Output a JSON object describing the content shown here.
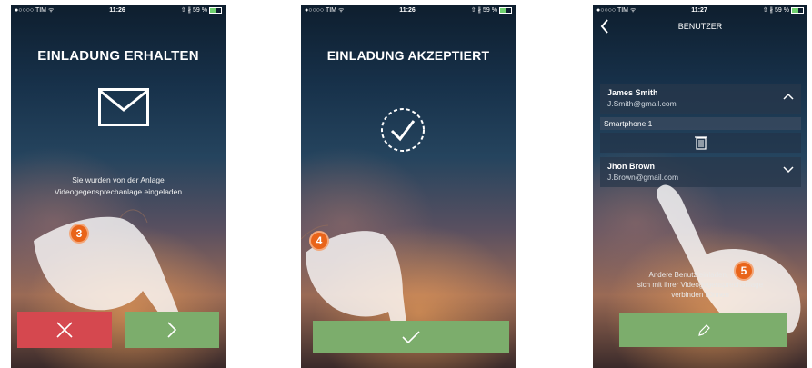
{
  "colors": {
    "red_button": "#d5484f",
    "green_button": "#7cad6c",
    "badge": "#e96419"
  },
  "status_bars": [
    {
      "carrier": "●○○○○ TIM ᯤ",
      "time": "11:26",
      "battery": "⇧ ∦ 59 %"
    },
    {
      "carrier": "●○○○○ TIM ᯤ",
      "time": "11:26",
      "battery": "⇧ ∦ 59 %"
    },
    {
      "carrier": "●○○○○ TIM ᯤ",
      "time": "11:27",
      "battery": "⇧ ∦ 59 %"
    }
  ],
  "screen1": {
    "title": "EINLADUNG ERHALTEN",
    "icon": "envelope-icon",
    "message_line1": "Sie wurden von der Anlage",
    "message_line2": "Videogegensprechanlage eingeladen",
    "step_badge": "3",
    "decline_icon": "close-icon",
    "accept_icon": "chevron-right-icon"
  },
  "screen2": {
    "title": "EINLADUNG AKZEPTIERT",
    "icon": "check-circle-icon",
    "step_badge": "4",
    "confirm_icon": "check-icon"
  },
  "screen3": {
    "header": "BENUTZER",
    "back_icon": "chevron-left-icon",
    "users": [
      {
        "name": "James Smith",
        "email": "J.Smith@gmail.com",
        "chevron": "chevron-up-icon"
      },
      {
        "name": "Jhon Brown",
        "email": "J.Brown@gmail.com",
        "chevron": "chevron-down-icon"
      }
    ],
    "device": "Smartphone 1",
    "trash_icon": "trash-icon",
    "info_line1": "Andere Benutz   einladen,   mit sie",
    "info_line2": "sich mit ihrer Videogegensprechanlage",
    "info_line3": "verbinden können",
    "step_badge": "5",
    "edit_icon": "pencil-icon"
  }
}
